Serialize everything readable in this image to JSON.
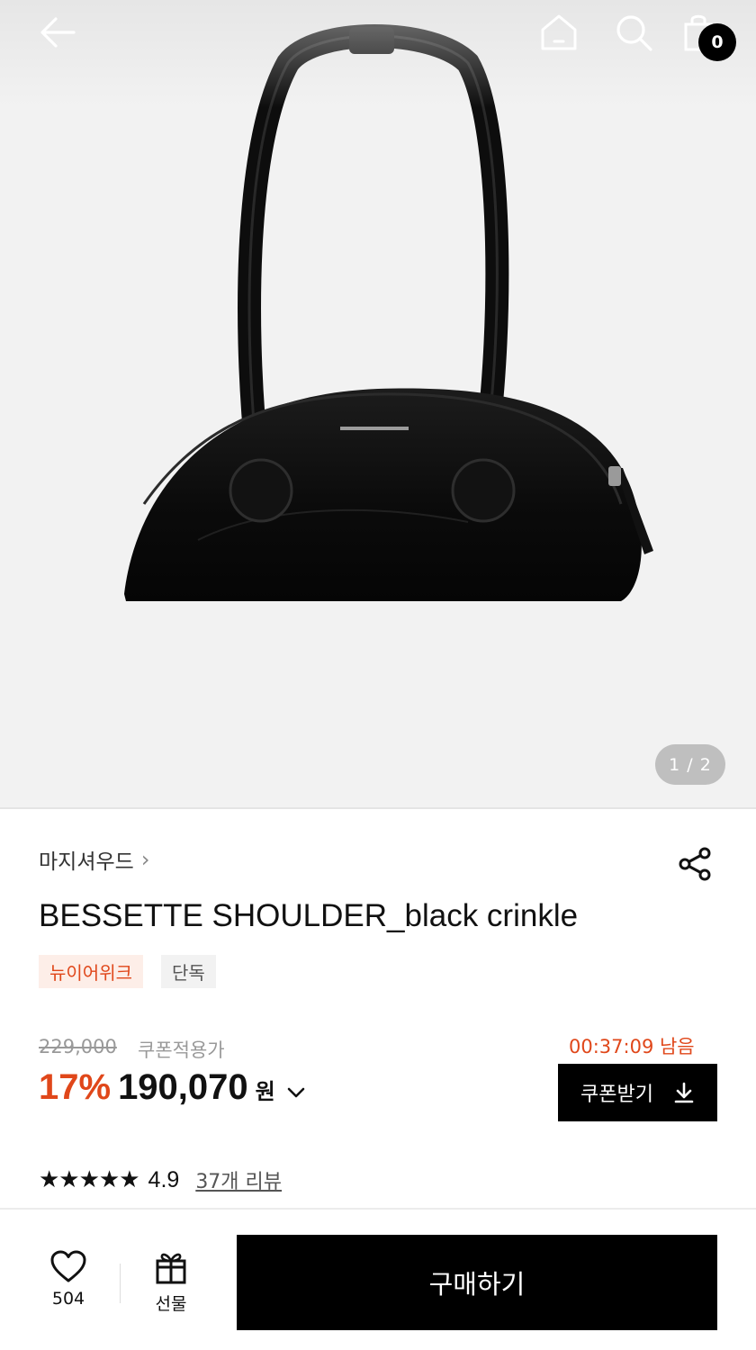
{
  "header": {
    "icons": [
      "back-arrow-icon",
      "home-icon",
      "search-icon",
      "shopping-bag-icon"
    ],
    "cart_count": "0"
  },
  "gallery": {
    "counter": "1 / 2",
    "product_image": "black-shoulder-bag"
  },
  "product": {
    "brand": "마지셔우드",
    "brand_chevron": "›",
    "title": "BESSETTE SHOULDER_black crinkle",
    "tags": [
      "뉴이어위크",
      "단독"
    ],
    "original_price": "229,000",
    "coupon_label": "쿠폰적용가",
    "discount": "17%",
    "final_price": "190,070",
    "currency": "원",
    "timer": "00:37:09 남음",
    "coupon_button": "쿠폰받기",
    "stars": "★★★★★",
    "rating": "4.9",
    "reviews": "37개 리뷰"
  },
  "bottom_bar": {
    "like_count": "504",
    "gift_label": "선물",
    "buy_label": "구매하기"
  },
  "colors": {
    "accent": "#e0471a",
    "tag_bg": "#fdeee8",
    "button_bg": "#000000"
  }
}
